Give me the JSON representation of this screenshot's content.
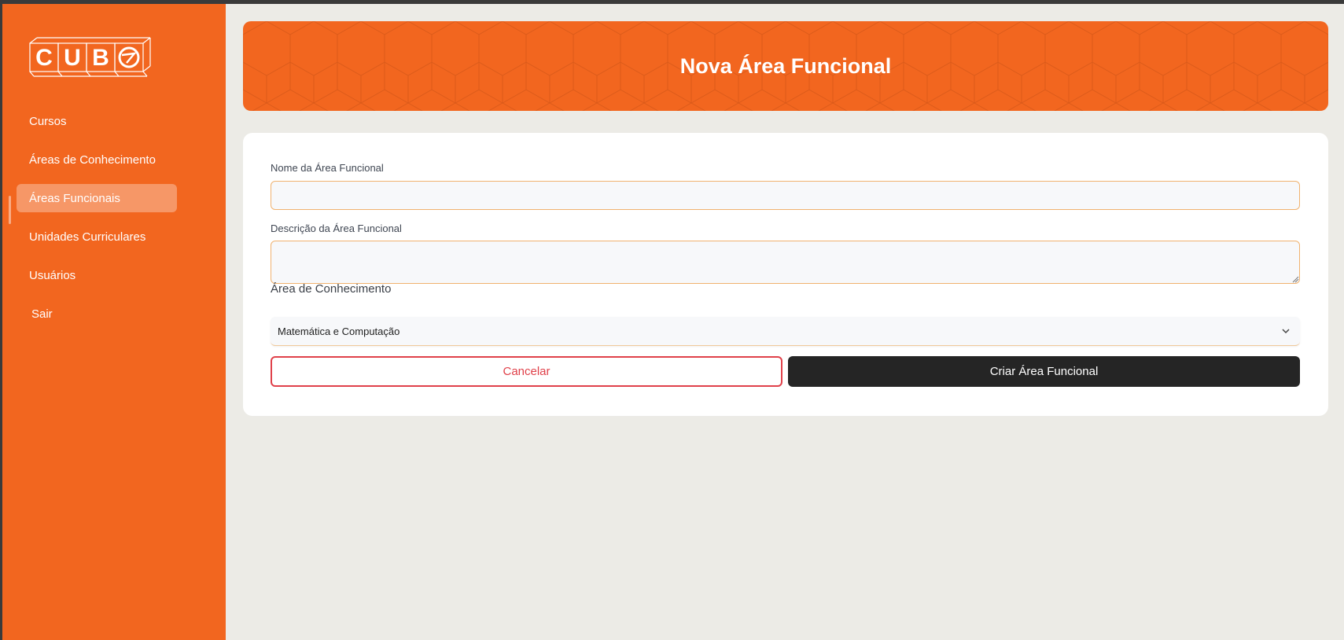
{
  "brand": {
    "logo_text": "CUBO"
  },
  "sidebar": {
    "items": [
      {
        "label": "Cursos",
        "active": false
      },
      {
        "label": "Áreas de Conhecimento",
        "active": false
      },
      {
        "label": "Áreas Funcionais",
        "active": true
      },
      {
        "label": "Unidades Curriculares",
        "active": false
      },
      {
        "label": "Usuários",
        "active": false
      },
      {
        "label": "Sair",
        "active": false
      }
    ]
  },
  "header": {
    "title": "Nova Área Funcional"
  },
  "form": {
    "name_label": "Nome da Área Funcional",
    "name_value": "",
    "description_label": "Descrição da Área Funcional",
    "description_value": "",
    "area_label": "Área de Conhecimento",
    "area_selected": "Matemática e Computação",
    "cancel_label": "Cancelar",
    "submit_label": "Criar Área Funcional"
  },
  "colors": {
    "accent": "#f2661f",
    "background": "#ecebe6",
    "danger": "#e0414a",
    "dark_button": "#252525"
  },
  "icons": {
    "select": "chevron-down-icon"
  }
}
